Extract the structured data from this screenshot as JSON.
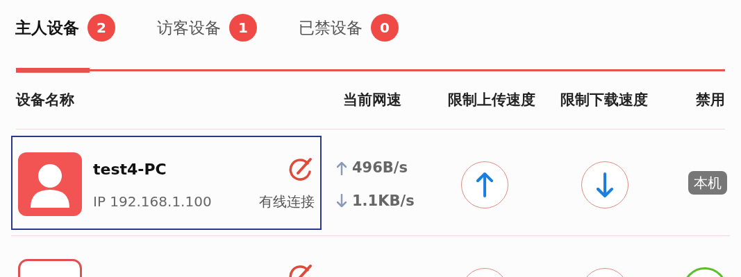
{
  "tabs": [
    {
      "label": "主人设备",
      "count": "2",
      "selected": true
    },
    {
      "label": "访客设备",
      "count": "1",
      "selected": false
    },
    {
      "label": "已禁设备",
      "count": "0",
      "selected": false
    }
  ],
  "columns": [
    "设备名称",
    "当前网速",
    "限制上传速度",
    "限制下载速度",
    "禁用"
  ],
  "rows": [
    {
      "name": "test4-PC",
      "ip": "IP 192.168.1.100",
      "connection": "有线连接",
      "upload": "496B/s",
      "download": "1.1KB/s",
      "selected": true,
      "avatar_filled": true,
      "disable": {
        "kind": "badge",
        "label": "本机"
      }
    },
    {
      "selected": false,
      "avatar_filled": false,
      "disable": {
        "kind": "toggle",
        "on": true
      }
    }
  ]
}
